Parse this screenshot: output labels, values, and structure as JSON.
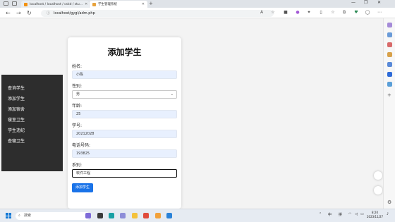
{
  "browser": {
    "tabs": [
      {
        "label": "localhost / localhost / cskd / stu..."
      },
      {
        "label": "学生管理系统"
      }
    ],
    "url": "localhost/gygl/adm.php",
    "new_tab_symbol": "+"
  },
  "sidebar": {
    "items": [
      {
        "label": "查询学生"
      },
      {
        "label": "添加学生"
      },
      {
        "label": "添加宿舍"
      },
      {
        "label": "寝室卫生"
      },
      {
        "label": "学生违纪"
      },
      {
        "label": "查寝卫生"
      }
    ]
  },
  "form": {
    "title": "添加学生",
    "name_label": "姓名:",
    "name_value": "小陈",
    "gender_label": "性别:",
    "gender_value": "男",
    "age_label": "年龄:",
    "age_value": "25",
    "student_id_label": "学号:",
    "student_id_value": "20212028",
    "phone_label": "电话号码:",
    "phone_value": "193825",
    "department_label": "系别:",
    "department_value": "软件工程",
    "submit_label": "添加学生"
  },
  "taskbar": {
    "search_placeholder": "搜索",
    "ime": "中",
    "ime_mode": "拼",
    "time": "8:20",
    "date": "2023/11/27"
  },
  "colors": {
    "accent": "#1a73e8",
    "sidebar_bg": "#2d2d2d",
    "input_bg": "#e8f0fe"
  }
}
